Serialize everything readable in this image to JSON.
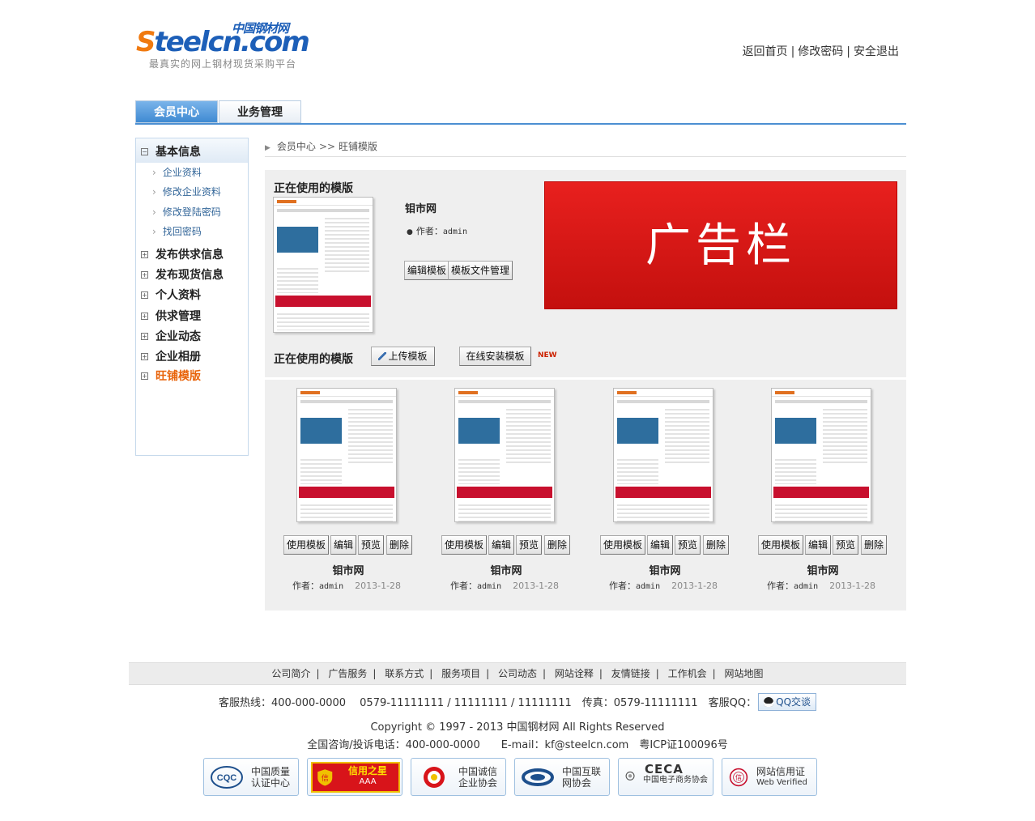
{
  "header": {
    "logo_cn": "中国钢材网",
    "logo_en_part1": "S",
    "logo_en_part2": "teelcn.com",
    "tagline": "最真实的网上钢材现货采购平台",
    "links": [
      "返回首页",
      "修改密码",
      "安全退出"
    ],
    "separator": "|"
  },
  "tabs": [
    "会员中心",
    "业务管理"
  ],
  "sidebar": {
    "items": [
      {
        "label": "基本信息",
        "toggle": "−"
      },
      {
        "label": "发布供求信息",
        "toggle": "+"
      },
      {
        "label": "发布现货信息",
        "toggle": "+"
      },
      {
        "label": "个人资料",
        "toggle": "+"
      },
      {
        "label": "供求管理",
        "toggle": "+"
      },
      {
        "label": "企业动态",
        "toggle": "+"
      },
      {
        "label": "企业相册",
        "toggle": "+"
      },
      {
        "label": "旺铺模版",
        "toggle": "+"
      }
    ],
    "subitems": [
      "企业资料",
      "修改企业资料",
      "修改登陆密码",
      "找回密码"
    ]
  },
  "breadcrumb": {
    "items": [
      "会员中心",
      "旺铺模版"
    ],
    "separator": ">>"
  },
  "current": {
    "section_title": "正在使用的模版",
    "site_name": "钼市网",
    "author_label": "作者：",
    "author": "admin",
    "buttons": [
      "编辑模板",
      "模板文件管理"
    ],
    "ad_text": "广告栏"
  },
  "upload_bar": {
    "section_title": "正在使用的模版",
    "upload_button": "上传模板",
    "install_button": "在线安装模板",
    "new_tag": "NEW"
  },
  "gallery": {
    "buttons": [
      "使用模板",
      "编辑",
      "预览",
      "删除"
    ],
    "items": [
      {
        "name": "钼市网",
        "author_label": "作者：",
        "author": "admin",
        "date": "2013-1-28"
      },
      {
        "name": "钼市网",
        "author_label": "作者：",
        "author": "admin",
        "date": "2013-1-28"
      },
      {
        "name": "钼市网",
        "author_label": "作者：",
        "author": "admin",
        "date": "2013-1-28"
      },
      {
        "name": "钼市网",
        "author_label": "作者：",
        "author": "admin",
        "date": "2013-1-28"
      }
    ]
  },
  "footer": {
    "nav": [
      "公司简介",
      "广告服务",
      "联系方式",
      "服务项目",
      "公司动态",
      "网站诠释",
      "友情链接",
      "工作机会",
      "网站地图"
    ],
    "separator": "|",
    "contact": "客服热线：400-000-0000　 0579-11111111 / 11111111 / 11111111　传真：0579-11111111　客服QQ：",
    "qq_button": "QQ交谈",
    "copyright": "Copyright © 1997 - 2013  中国钢材网 All Rights Reserved",
    "complaint": "全国咨询/投诉电话：400-000-0000　　E-mail：kf@steelcn.com　粤ICP证100096号",
    "badges": [
      {
        "icon": "cqc-logo-icon",
        "line1": "中国质量",
        "line2": "认证中心"
      },
      {
        "icon": "credit-star-icon",
        "line1": "信用之星",
        "line2": "AAA"
      },
      {
        "icon": "integrity-assoc-icon",
        "line1": "中国诚信",
        "line2": "企业协会"
      },
      {
        "icon": "isc-logo-icon",
        "line1": "中国互联",
        "line2": "网协会"
      },
      {
        "icon": "ceca-logo-icon",
        "line1": "CECA",
        "line2": "中国电子商务协会"
      },
      {
        "icon": "web-verified-icon",
        "line1": "网站信用证",
        "line2": "Web Verified"
      }
    ]
  },
  "colors": {
    "brand_orange": "#f07a10",
    "brand_blue": "#1d5fb8",
    "tab_active": "#4c8fd2",
    "current_nav": "#e8630a",
    "ad_red": "#d8181a"
  }
}
